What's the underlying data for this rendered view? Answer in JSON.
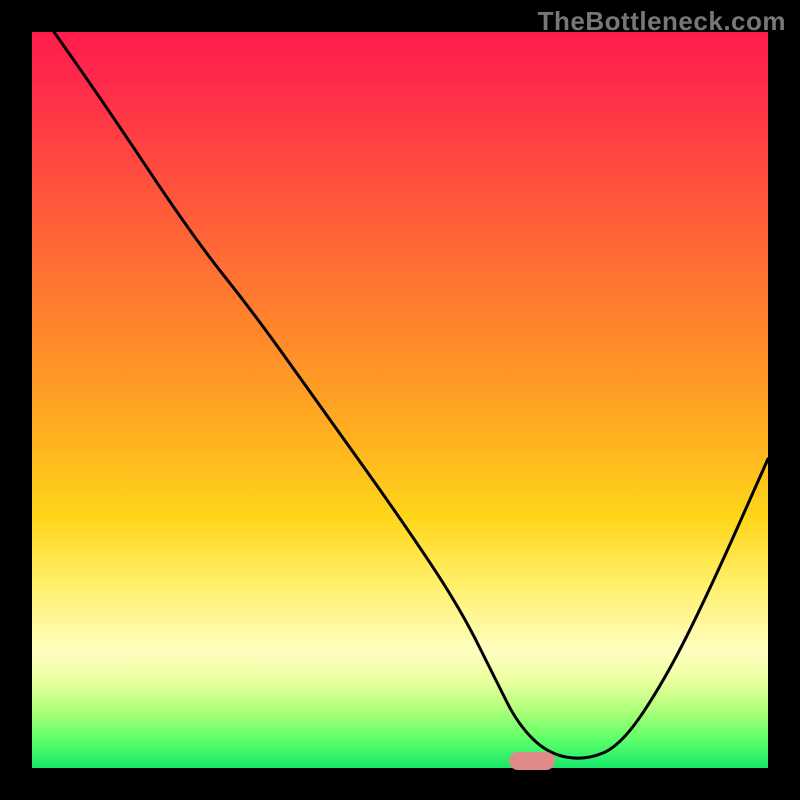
{
  "watermark": "TheBottleneck.com",
  "chart_data": {
    "type": "line",
    "title": "",
    "xlabel": "",
    "ylabel": "",
    "xlim": [
      0,
      100
    ],
    "ylim": [
      0,
      100
    ],
    "grid": false,
    "legend": false,
    "series": [
      {
        "name": "bottleneck-curve",
        "x": [
          3,
          10,
          22,
          30,
          40,
          50,
          58,
          63,
          66,
          70,
          75,
          80,
          86,
          92,
          100
        ],
        "y": [
          100,
          90,
          72,
          62,
          48,
          34,
          22,
          12,
          6,
          2,
          1,
          3,
          12,
          24,
          42
        ]
      }
    ],
    "gradient_stops": [
      {
        "pos": 0,
        "color": "#ff1c4d"
      },
      {
        "pos": 18,
        "color": "#ff4a3f"
      },
      {
        "pos": 42,
        "color": "#ff8a2a"
      },
      {
        "pos": 66,
        "color": "#ffd61a"
      },
      {
        "pos": 84,
        "color": "#fffec0"
      },
      {
        "pos": 100,
        "color": "#18e86a"
      }
    ],
    "marker": {
      "name": "optimal-range",
      "x_center": 68,
      "y": 1,
      "color": "#e08a8a"
    }
  }
}
